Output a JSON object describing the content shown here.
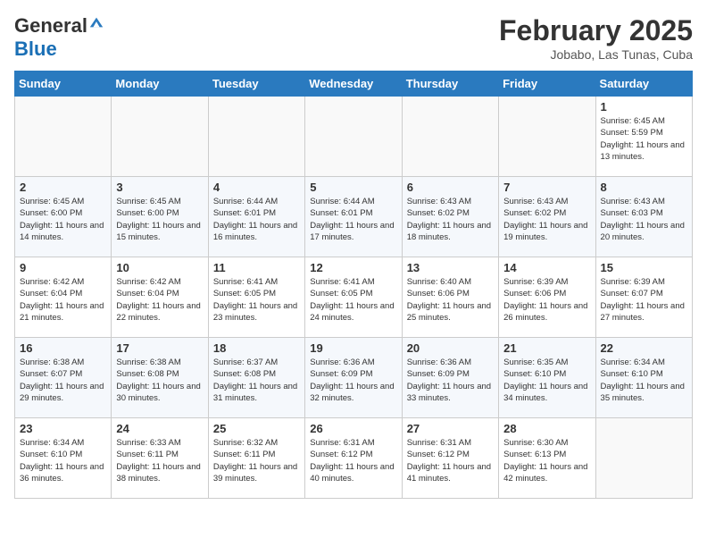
{
  "header": {
    "logo_general": "General",
    "logo_blue": "Blue",
    "month_title": "February 2025",
    "location": "Jobabo, Las Tunas, Cuba"
  },
  "weekdays": [
    "Sunday",
    "Monday",
    "Tuesday",
    "Wednesday",
    "Thursday",
    "Friday",
    "Saturday"
  ],
  "weeks": [
    [
      {
        "day": "",
        "info": ""
      },
      {
        "day": "",
        "info": ""
      },
      {
        "day": "",
        "info": ""
      },
      {
        "day": "",
        "info": ""
      },
      {
        "day": "",
        "info": ""
      },
      {
        "day": "",
        "info": ""
      },
      {
        "day": "1",
        "info": "Sunrise: 6:45 AM\nSunset: 5:59 PM\nDaylight: 11 hours and 13 minutes."
      }
    ],
    [
      {
        "day": "2",
        "info": "Sunrise: 6:45 AM\nSunset: 6:00 PM\nDaylight: 11 hours and 14 minutes."
      },
      {
        "day": "3",
        "info": "Sunrise: 6:45 AM\nSunset: 6:00 PM\nDaylight: 11 hours and 15 minutes."
      },
      {
        "day": "4",
        "info": "Sunrise: 6:44 AM\nSunset: 6:01 PM\nDaylight: 11 hours and 16 minutes."
      },
      {
        "day": "5",
        "info": "Sunrise: 6:44 AM\nSunset: 6:01 PM\nDaylight: 11 hours and 17 minutes."
      },
      {
        "day": "6",
        "info": "Sunrise: 6:43 AM\nSunset: 6:02 PM\nDaylight: 11 hours and 18 minutes."
      },
      {
        "day": "7",
        "info": "Sunrise: 6:43 AM\nSunset: 6:02 PM\nDaylight: 11 hours and 19 minutes."
      },
      {
        "day": "8",
        "info": "Sunrise: 6:43 AM\nSunset: 6:03 PM\nDaylight: 11 hours and 20 minutes."
      }
    ],
    [
      {
        "day": "9",
        "info": "Sunrise: 6:42 AM\nSunset: 6:04 PM\nDaylight: 11 hours and 21 minutes."
      },
      {
        "day": "10",
        "info": "Sunrise: 6:42 AM\nSunset: 6:04 PM\nDaylight: 11 hours and 22 minutes."
      },
      {
        "day": "11",
        "info": "Sunrise: 6:41 AM\nSunset: 6:05 PM\nDaylight: 11 hours and 23 minutes."
      },
      {
        "day": "12",
        "info": "Sunrise: 6:41 AM\nSunset: 6:05 PM\nDaylight: 11 hours and 24 minutes."
      },
      {
        "day": "13",
        "info": "Sunrise: 6:40 AM\nSunset: 6:06 PM\nDaylight: 11 hours and 25 minutes."
      },
      {
        "day": "14",
        "info": "Sunrise: 6:39 AM\nSunset: 6:06 PM\nDaylight: 11 hours and 26 minutes."
      },
      {
        "day": "15",
        "info": "Sunrise: 6:39 AM\nSunset: 6:07 PM\nDaylight: 11 hours and 27 minutes."
      }
    ],
    [
      {
        "day": "16",
        "info": "Sunrise: 6:38 AM\nSunset: 6:07 PM\nDaylight: 11 hours and 29 minutes."
      },
      {
        "day": "17",
        "info": "Sunrise: 6:38 AM\nSunset: 6:08 PM\nDaylight: 11 hours and 30 minutes."
      },
      {
        "day": "18",
        "info": "Sunrise: 6:37 AM\nSunset: 6:08 PM\nDaylight: 11 hours and 31 minutes."
      },
      {
        "day": "19",
        "info": "Sunrise: 6:36 AM\nSunset: 6:09 PM\nDaylight: 11 hours and 32 minutes."
      },
      {
        "day": "20",
        "info": "Sunrise: 6:36 AM\nSunset: 6:09 PM\nDaylight: 11 hours and 33 minutes."
      },
      {
        "day": "21",
        "info": "Sunrise: 6:35 AM\nSunset: 6:10 PM\nDaylight: 11 hours and 34 minutes."
      },
      {
        "day": "22",
        "info": "Sunrise: 6:34 AM\nSunset: 6:10 PM\nDaylight: 11 hours and 35 minutes."
      }
    ],
    [
      {
        "day": "23",
        "info": "Sunrise: 6:34 AM\nSunset: 6:10 PM\nDaylight: 11 hours and 36 minutes."
      },
      {
        "day": "24",
        "info": "Sunrise: 6:33 AM\nSunset: 6:11 PM\nDaylight: 11 hours and 38 minutes."
      },
      {
        "day": "25",
        "info": "Sunrise: 6:32 AM\nSunset: 6:11 PM\nDaylight: 11 hours and 39 minutes."
      },
      {
        "day": "26",
        "info": "Sunrise: 6:31 AM\nSunset: 6:12 PM\nDaylight: 11 hours and 40 minutes."
      },
      {
        "day": "27",
        "info": "Sunrise: 6:31 AM\nSunset: 6:12 PM\nDaylight: 11 hours and 41 minutes."
      },
      {
        "day": "28",
        "info": "Sunrise: 6:30 AM\nSunset: 6:13 PM\nDaylight: 11 hours and 42 minutes."
      },
      {
        "day": "",
        "info": ""
      }
    ]
  ]
}
